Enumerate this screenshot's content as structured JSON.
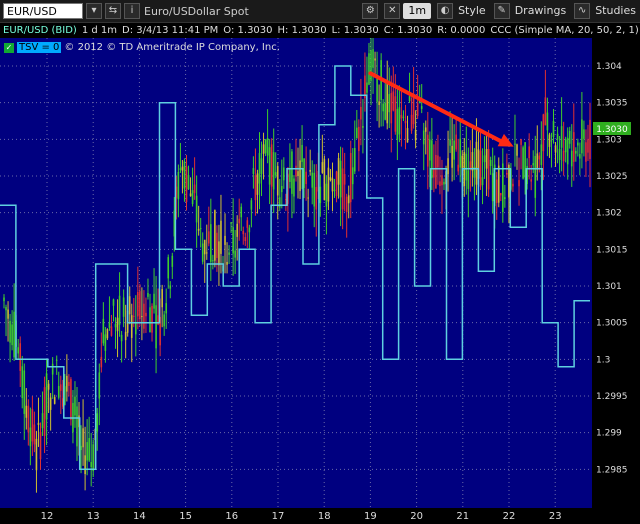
{
  "toolbar": {
    "symbol": "EUR/USD",
    "description": "Euro/USDollar Spot",
    "timeframe": "1m",
    "style_label": "Style",
    "drawings_label": "Drawings",
    "studies_label": "Studies"
  },
  "infobar": {
    "symbol": "EUR/USD (BID)",
    "aggregation": "1 d 1m",
    "datetime": "D: 3/4/13 11:41 PM",
    "open": "O: 1.3030",
    "high": "H: 1.3030",
    "low": "L: 1.3030",
    "close": "C: 1.3030",
    "change": "R: 0.0000",
    "study": "CCC (Simple MA, 20, 50, 2, 1)"
  },
  "overlay": {
    "study_label": "TSV = 0",
    "copyright": "© 2012 © TD Ameritrade IP Company, Inc."
  },
  "price_badge": "1.3030",
  "colors": {
    "background": "#000080",
    "grid": "#6a6aa8",
    "indicator": "#5fd0e0",
    "arrow": "#ff2a14",
    "candle_up": "#3fcf2a",
    "candle_down": "#e03030"
  },
  "chart_data": {
    "type": "line",
    "y_ticks": [
      "1.304",
      "1.3035",
      "1.303",
      "1.3025",
      "1.302",
      "1.3015",
      "1.301",
      "1.3005",
      "1.3",
      "1.2995",
      "1.299",
      "1.2985"
    ],
    "x_ticks": [
      "12",
      "13",
      "14",
      "15",
      "16",
      "17",
      "18",
      "19",
      "20",
      "21",
      "22",
      "23"
    ],
    "ylim": [
      1.2983,
      1.3043
    ],
    "price_series": [
      1.3008,
      1.3003,
      1.2994,
      1.2987,
      1.2996,
      1.2998,
      1.2995,
      1.2988,
      1.2986,
      1.3003,
      1.3006,
      1.3005,
      1.3006,
      1.3008,
      1.3004,
      1.3012,
      1.3027,
      1.3022,
      1.3016,
      1.3017,
      1.3015,
      1.3016,
      1.3019,
      1.3026,
      1.3027,
      1.3024,
      1.3025,
      1.3026,
      1.3023,
      1.3024,
      1.3025,
      1.3022,
      1.303,
      1.304,
      1.3038,
      1.3034,
      1.3031,
      1.3034,
      1.3031,
      1.3025,
      1.3027,
      1.3029,
      1.3026,
      1.3027,
      1.3025,
      1.3023,
      1.3026,
      1.3027,
      1.3025,
      1.3033,
      1.303,
      1.3029,
      1.3029,
      1.303
    ],
    "indicator_series": [
      1.3021,
      1.3,
      1.3,
      1.2999,
      1.2992,
      1.2985,
      1.3013,
      1.3013,
      1.3005,
      1.3005,
      1.3035,
      1.3015,
      1.3006,
      1.3013,
      1.301,
      1.3015,
      1.3005,
      1.3021,
      1.3026,
      1.3013,
      1.3032,
      1.304,
      1.3036,
      1.3022,
      1.3,
      1.3026,
      1.301,
      1.3026,
      1.3,
      1.3026,
      1.3012,
      1.3026,
      1.3018,
      1.3026,
      1.3005,
      1.2999,
      1.3008
    ],
    "annotation": {
      "type": "arrow",
      "from": [
        "19.0",
        1.3039
      ],
      "to": [
        "22.1",
        1.3029
      ]
    }
  }
}
